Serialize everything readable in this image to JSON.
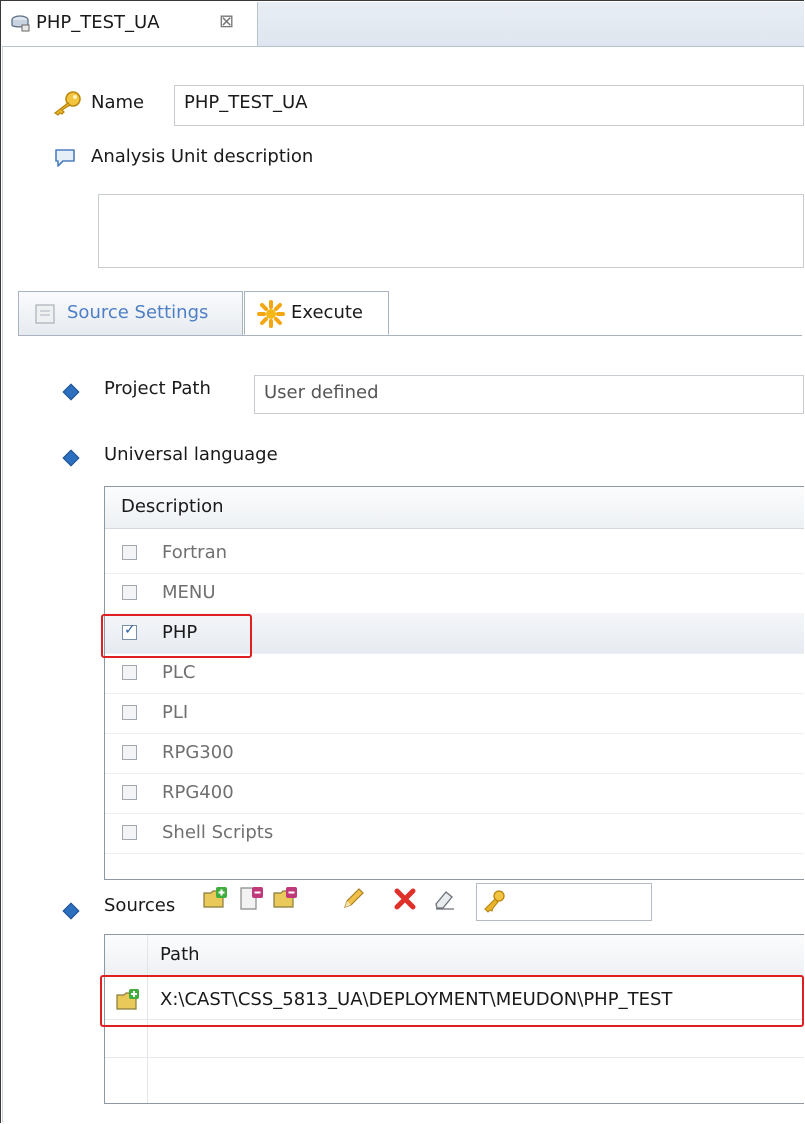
{
  "editor_tab": {
    "title": "PHP_TEST_UA",
    "close_glyph": "⊠"
  },
  "name_field": {
    "label": "Name",
    "value": "PHP_TEST_UA"
  },
  "description": {
    "label": "Analysis Unit description",
    "value": ""
  },
  "section_tabs": [
    {
      "label": "Source Settings",
      "selected": false
    },
    {
      "label": "Execute",
      "selected": true
    }
  ],
  "project_path": {
    "label": "Project Path",
    "value": "User defined"
  },
  "universal_language": {
    "label": "Universal language",
    "column_header": "Description",
    "items": [
      {
        "label": "Fortran",
        "checked": false
      },
      {
        "label": "MENU",
        "checked": false
      },
      {
        "label": "PHP",
        "checked": true
      },
      {
        "label": "PLC",
        "checked": false
      },
      {
        "label": "PLI",
        "checked": false
      },
      {
        "label": "RPG300",
        "checked": false
      },
      {
        "label": "RPG400",
        "checked": false
      },
      {
        "label": "Shell Scripts",
        "checked": false
      }
    ]
  },
  "sources": {
    "label": "Sources",
    "toolbar_icons": [
      "add-folder-icon",
      "remove-file-icon",
      "remove-folder-icon",
      "edit-pencil-icon",
      "delete-x-icon",
      "eraser-icon",
      "key-icon"
    ],
    "filter_value": "",
    "column_header": "Path",
    "rows": [
      {
        "path": "X:\\CAST\\CSS_5813_UA\\DEPLOYMENT\\MEUDON\\PHP_TEST"
      }
    ]
  },
  "colors": {
    "highlight_border": "#e02020",
    "inactive_tab_text": "#4e7fc5",
    "diamond_bullet": "#2c6fbe"
  }
}
